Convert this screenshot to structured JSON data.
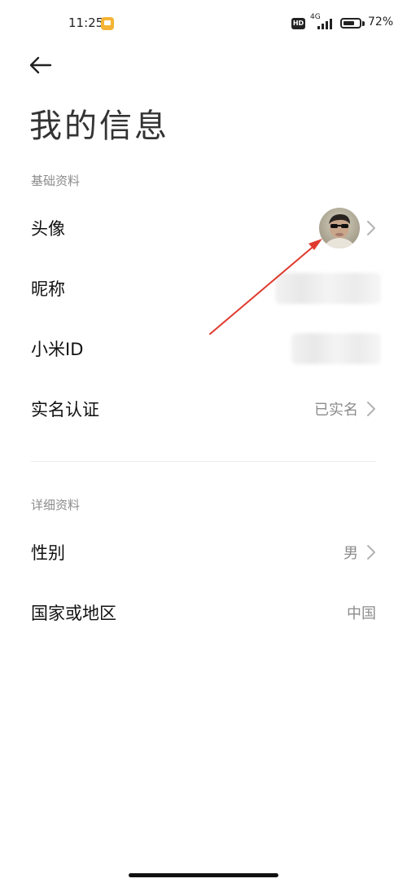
{
  "status_bar": {
    "time": "11:25",
    "network_type": "4G",
    "hd_label": "HD",
    "battery_percent": "72%",
    "battery_level": 0.72
  },
  "header": {
    "title": "我的信息"
  },
  "sections": {
    "basic": {
      "label": "基础资料",
      "avatar_label": "头像",
      "nickname_label": "昵称",
      "mi_id_label": "小米ID",
      "verification_label": "实名认证",
      "verification_value": "已实名"
    },
    "detail": {
      "label": "详细资料",
      "gender_label": "性别",
      "gender_value": "男",
      "region_label": "国家或地区",
      "region_value": "中国"
    }
  },
  "colors": {
    "annotation_arrow": "#e03a2e",
    "notification_badge": "#f5b335"
  }
}
